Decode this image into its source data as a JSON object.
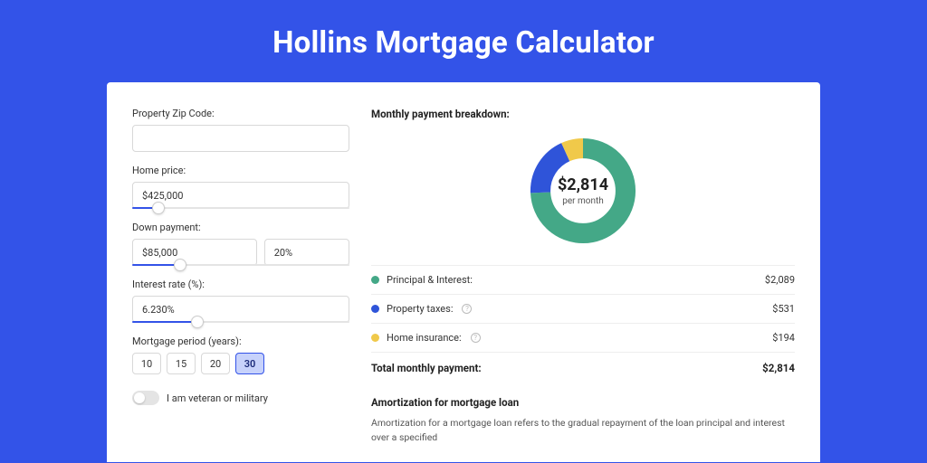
{
  "page": {
    "title": "Hollins Mortgage Calculator"
  },
  "form": {
    "zip": {
      "label": "Property Zip Code:",
      "value": ""
    },
    "home_price": {
      "label": "Home price:",
      "value": "$425,000",
      "slider_fill": "12%"
    },
    "down_payment": {
      "label": "Down payment:",
      "value": "$85,000",
      "pct": "20%",
      "slider_fill": "22%"
    },
    "interest_rate": {
      "label": "Interest rate (%):",
      "value": "6.230%",
      "slider_fill": "30%"
    },
    "period": {
      "label": "Mortgage period (years):",
      "options": [
        "10",
        "15",
        "20",
        "30"
      ],
      "selected": "30"
    },
    "veteran": {
      "label": "I am veteran or military",
      "checked": false
    }
  },
  "breakdown": {
    "title": "Monthly payment breakdown:",
    "donut": {
      "amount": "$2,814",
      "sub": "per month"
    },
    "items": [
      {
        "label": "Principal & Interest:",
        "value": "$2,089",
        "color": "#44a887",
        "info": false
      },
      {
        "label": "Property taxes:",
        "value": "$531",
        "color": "#2f54d9",
        "info": true
      },
      {
        "label": "Home insurance:",
        "value": "$194",
        "color": "#f0c94a",
        "info": true
      }
    ],
    "total": {
      "label": "Total monthly payment:",
      "value": "$2,814"
    }
  },
  "amortization": {
    "title": "Amortization for mortgage loan",
    "text": "Amortization for a mortgage loan refers to the gradual repayment of the loan principal and interest over a specified"
  },
  "chart_data": {
    "type": "pie",
    "title": "Monthly payment breakdown",
    "categories": [
      "Principal & Interest",
      "Property taxes",
      "Home insurance"
    ],
    "values": [
      2089,
      531,
      194
    ],
    "colors": [
      "#44a887",
      "#2f54d9",
      "#f0c94a"
    ],
    "total": 2814,
    "center_label": "$2,814 per month"
  }
}
